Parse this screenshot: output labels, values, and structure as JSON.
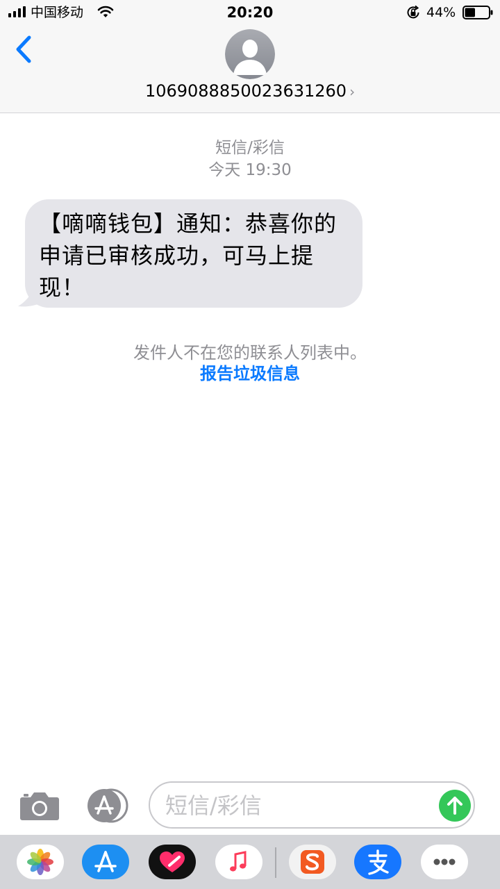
{
  "status_bar": {
    "carrier": "中国移动",
    "time": "20:20",
    "battery_percent": "44%",
    "battery_level": 0.44
  },
  "header": {
    "back_icon": "chevron-left-icon",
    "contact_number": "1069088850023631260",
    "contact_chevron": "›"
  },
  "thread": {
    "message_type": "短信/彩信",
    "timestamp": "今天 19:30",
    "messages": [
      {
        "direction": "incoming",
        "text": "【嘀嘀钱包】通知：恭喜你的申请已审核成功，可马上提现！"
      }
    ],
    "unknown_sender_notice": "发件人不在您的联系人列表中。",
    "report_link": "报告垃圾信息"
  },
  "compose": {
    "placeholder": "短信/彩信",
    "value": ""
  },
  "app_drawer": {
    "icons": [
      "photos-icon",
      "app-store-icon",
      "digital-touch-icon",
      "music-icon",
      "sogou-input-icon",
      "alipay-icon",
      "more-icon"
    ]
  },
  "colors": {
    "accent": "#0a7aff",
    "bubble": "#e5e5ea",
    "send": "#34c759",
    "muted": "#8e8e93"
  }
}
